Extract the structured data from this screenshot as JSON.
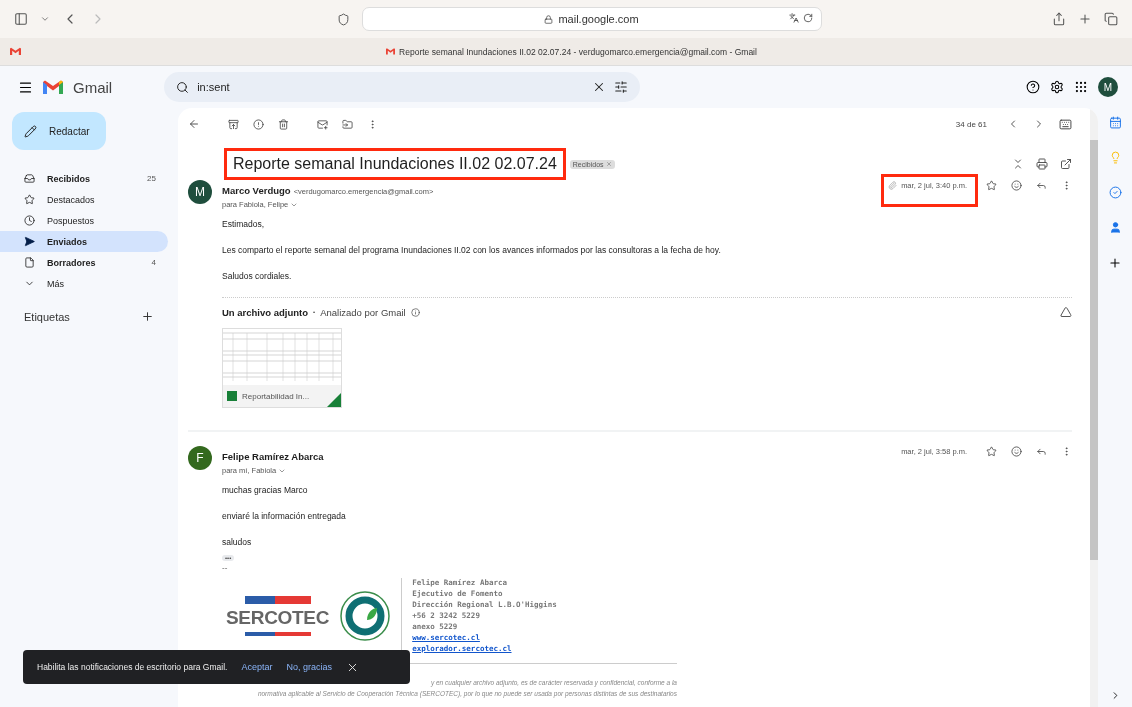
{
  "browser": {
    "url": "mail.google.com",
    "tab_title": "Reporte semanal Inundaciones II.02 02.07.24 - verdugomarco.emergencia@gmail.com - Gmail"
  },
  "header": {
    "app_name": "Gmail",
    "search_query": "in:sent",
    "avatar_letter": "M"
  },
  "sidebar": {
    "compose_label": "Redactar",
    "items": [
      {
        "kind": "inbox",
        "label": "Recibidos",
        "count": "25",
        "unread": true,
        "selected": false
      },
      {
        "kind": "star",
        "label": "Destacados",
        "unread": false,
        "selected": false
      },
      {
        "kind": "clock",
        "label": "Pospuestos",
        "unread": false,
        "selected": false
      },
      {
        "kind": "sent",
        "label": "Enviados",
        "unread": true,
        "selected": true
      },
      {
        "kind": "draft",
        "label": "Borradores",
        "count": "4",
        "unread": true,
        "selected": false
      },
      {
        "kind": "more",
        "label": "Más",
        "unread": false,
        "selected": false
      }
    ],
    "labels_heading": "Etiquetas"
  },
  "toolbar": {
    "position": "34 de 61"
  },
  "thread": {
    "subject": "Reporte semanal Inundaciones II.02 02.07.24",
    "subject_highlighted": true,
    "label_chip": "Recibidos"
  },
  "messages": [
    {
      "avatar_letter": "M",
      "color": "#1f4e3d",
      "sender": "Marco Verdugo",
      "email": "<verdugomarco.emergencia@gmail.com>",
      "recipients": "para Fabiola, Felipe",
      "date": "mar, 2 jul, 3:40 p.m.",
      "date_highlighted": true,
      "has_attachment": true,
      "body": [
        "Estimados,",
        "Les comparto el reporte semanal del programa Inundaciones II.02 con los avances informados por las consultoras a la fecha de hoy.",
        "Saludos cordiales."
      ],
      "attachment": {
        "heading": "Un archivo adjunto",
        "bullet": "•",
        "scan_note": "Analizado por Gmail",
        "file_name": "Reportabilidad In..."
      }
    },
    {
      "avatar_letter": "F",
      "color": "#33691e",
      "sender": "Felipe Ramírez Abarca",
      "recipients": "para mí, Fabiola",
      "date": "mar, 2 jul, 3:58 p.m.",
      "date_highlighted": false,
      "has_attachment": false,
      "body": [
        "muchas gracias Marco",
        "enviaré la información entregada",
        "saludos"
      ],
      "trimmed": "•••",
      "separator": "--",
      "signature": {
        "logo_text": "SERCOTEC",
        "lines": [
          "Felipe Ramírez Abarca",
          "Ejecutivo de Fomento",
          "Dirección Regional L.B.O'Higgins",
          "+56 2 3242 5229",
          "anexo 5229"
        ],
        "links": [
          "www.sercotec.cl",
          "explorador.sercotec.cl"
        ]
      },
      "disclaimer": [
        "y en cualquier archivo adjunto, es de carácter reservada y confidencial, conforme a la",
        "normativa aplicable al Servicio de Cooperación Técnica (SERCOTEC), por lo que no puede ser usada por personas distintas de sus destinatarios"
      ]
    }
  ],
  "toast": {
    "text": "Habilita las notificaciones de escritorio para Gmail.",
    "accept": "Aceptar",
    "decline": "No, gracias"
  }
}
